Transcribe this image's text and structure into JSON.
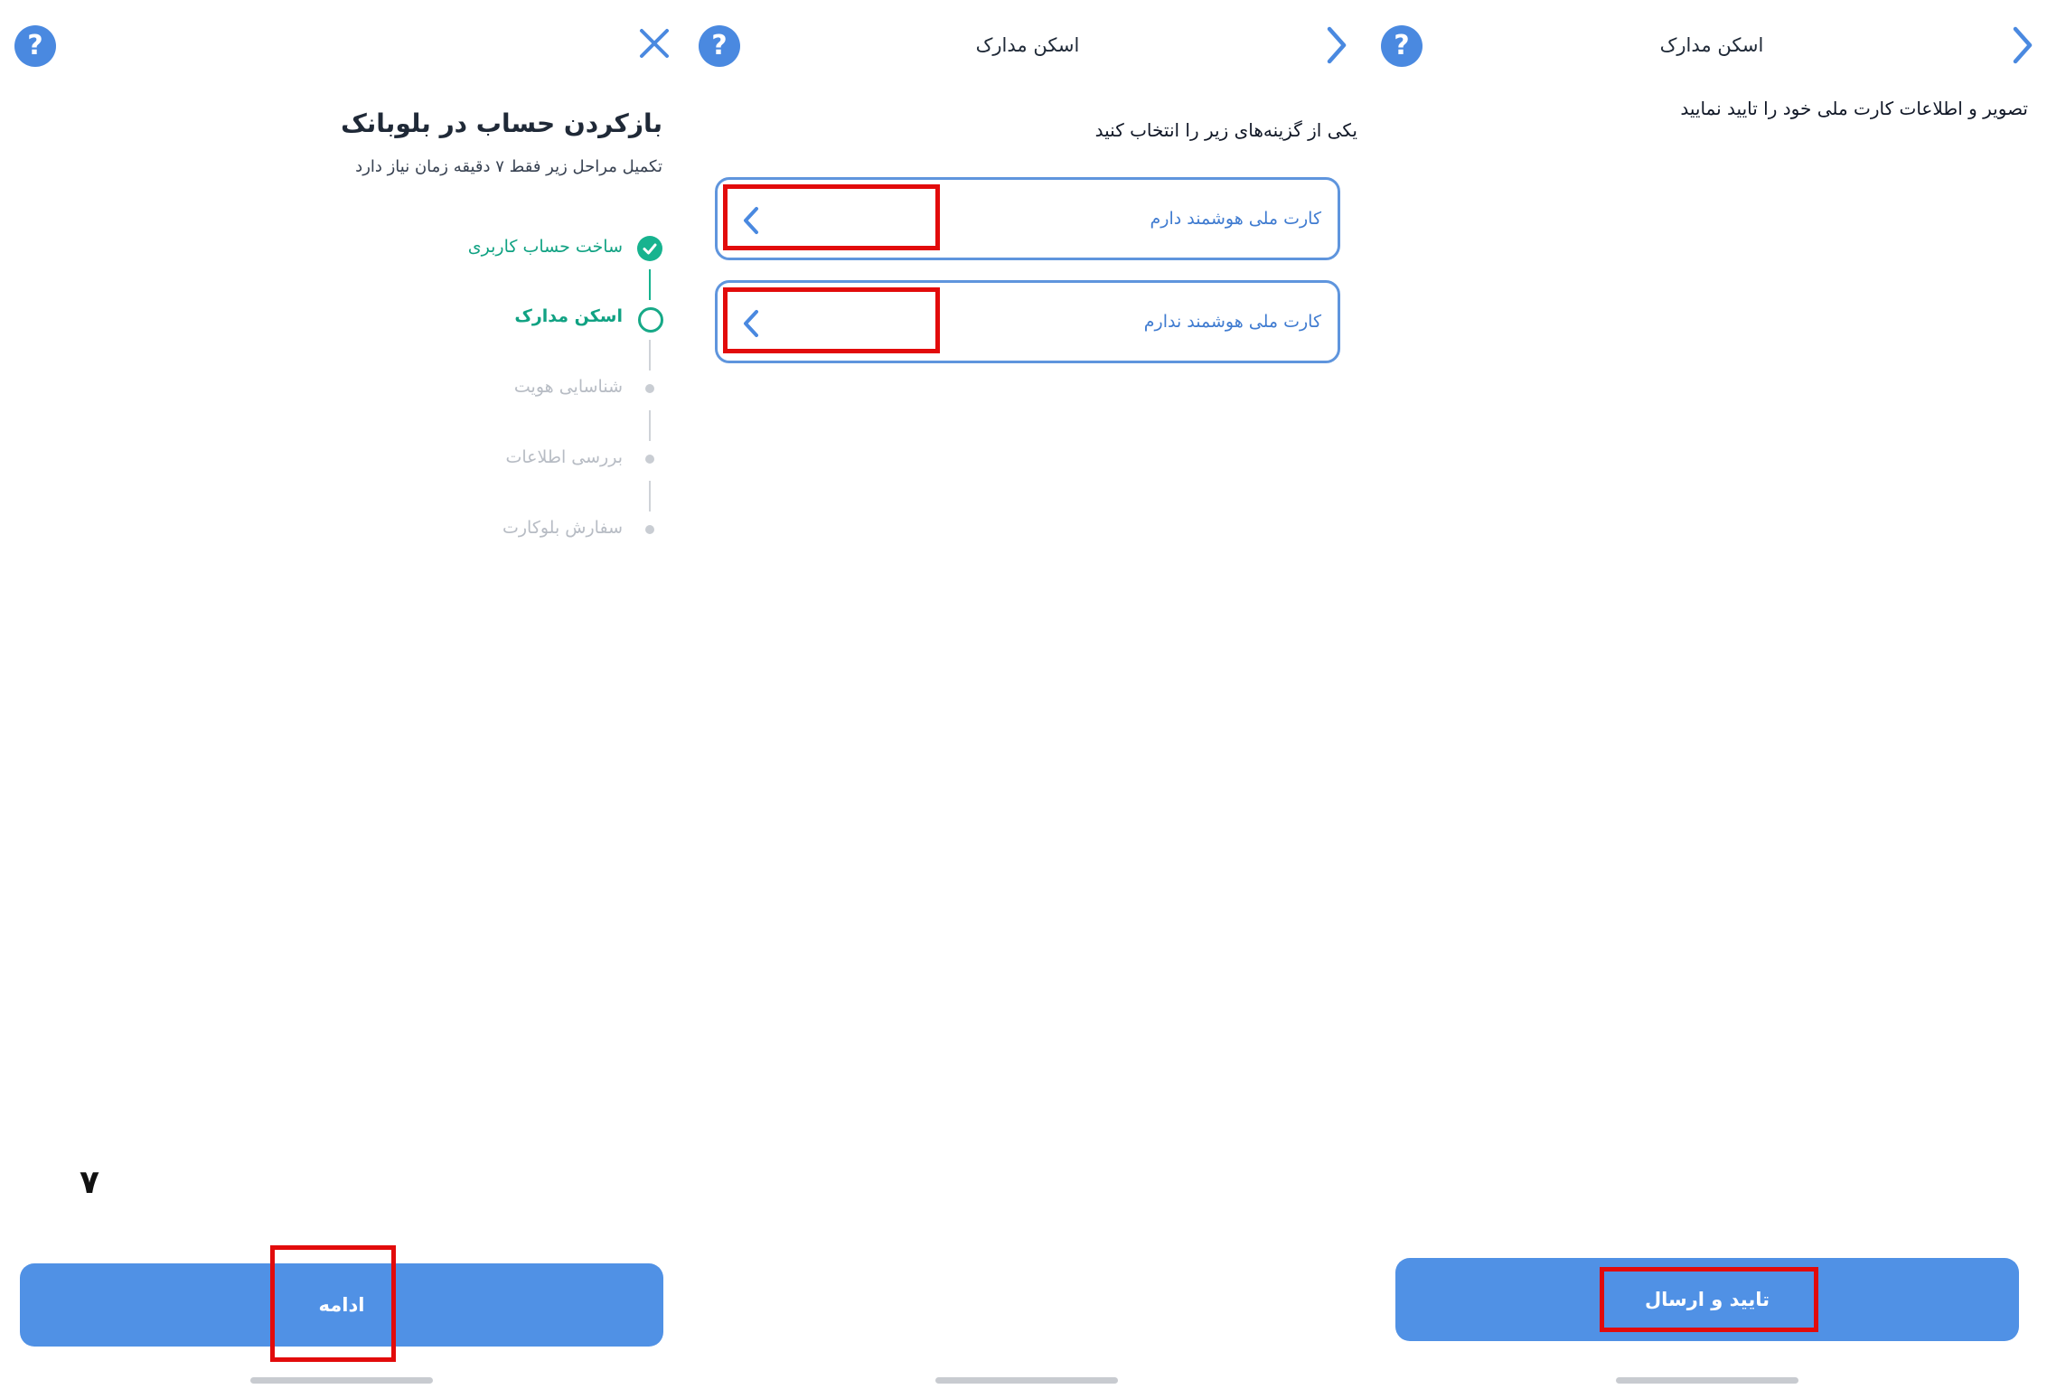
{
  "panel1": {
    "help_glyph": "?",
    "close_glyph": "✕",
    "heading": "بازکردن حساب در بلوبانک",
    "subheading": "تکمیل مراحل زیر فقط ۷ دقیقه زمان نیاز دارد",
    "steps": [
      {
        "label": "ساخت حساب کاربری",
        "state": "done"
      },
      {
        "label": "اسکن مدارک",
        "state": "current"
      },
      {
        "label": "شناسایی هویت",
        "state": "todo"
      },
      {
        "label": "بررسی اطلاعات",
        "state": "todo"
      },
      {
        "label": "سفارش بلوکارت",
        "state": "todo"
      }
    ],
    "annotation_number": "۷",
    "continue_label": "ادامه"
  },
  "panel2": {
    "help_glyph": "?",
    "title": "اسکن مدارک",
    "instruction": "یکی از گزینه‌های زیر را انتخاب کنید",
    "options": [
      {
        "label": "کارت ملی هوشمند دارم"
      },
      {
        "label": "کارت ملی هوشمند ندارم"
      }
    ]
  },
  "panel3": {
    "help_glyph": "?",
    "title": "اسکن مدارک",
    "instruction": "تصویر و اطلاعات کارت ملی خود را تایید نمایید",
    "submit_label": "تایید و ارسال"
  },
  "colors": {
    "accent": "#4a89e0",
    "button": "#5091e5",
    "success": "#17b38f",
    "highlight": "#e20b0b",
    "muted": "#b7bcc4"
  }
}
